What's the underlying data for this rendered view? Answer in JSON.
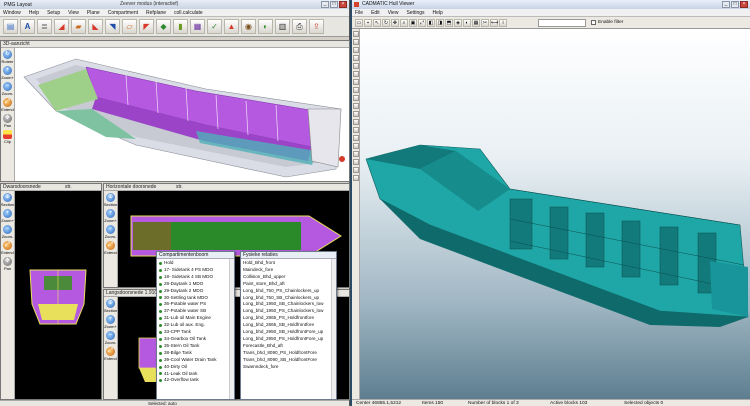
{
  "left_window": {
    "title": "PMG Layout",
    "document": "Zeever modus (interactief)",
    "menu": [
      "Window",
      "Help",
      "Setup",
      "View",
      "Plane",
      "Compartment",
      "Refplane",
      "coll.calculate"
    ],
    "pane_3d_caption": "3D-aanzicht",
    "pane_section_caption": "Dwarsdoorsnede",
    "pane_section_caption2": "str.",
    "pane_horizontal_caption": "Horizontale doorsnede",
    "pane_horizontal_caption2": "str.",
    "pane_longitudinal_caption": "Langsdoorsnede 1.910",
    "side_buttons": {
      "rotate": "Roteer",
      "zoom_in": "Zoom+",
      "zoom_out": "Zoom-",
      "extend": "Extend",
      "pan": "Pan",
      "clip": "Clip",
      "section": "Section"
    },
    "compartments": {
      "caption": "Compartimentenboom",
      "items": [
        "Hold",
        "17- Sidetank 4 PS MDO",
        "18- Sidetank 4 SB MDO",
        "28-Daytank 1 MDO",
        "29-Daytank 2 MDO",
        "30-Settling tank MDO",
        "36-Potable water PS",
        "37-Potable water SB",
        "31-Lub oil Main Engine",
        "32-Lub oil aux. Eng.",
        "33-CPP Tank",
        "34-Gearbox Oil Tank",
        "35-Stern Oil Tank",
        "38-Bilge Tank",
        "39-Cool Water Drain Tank",
        "40-Dirty Oil",
        "41-Leak Oil tank",
        "42-Overflow tank"
      ]
    },
    "walls": {
      "caption": "Fysieke relaties",
      "items": [
        "Hold_Bhd_front",
        "Maindeck_fore",
        "Collision_Bhd_upper",
        "Paint_store_Bhd_aft",
        "Long_bhd_750_PS_Chainlockers_up",
        "Long_bhd_750_SB_Chainlockers_up",
        "Long_bhd_1950_SB_Chainlockers_low",
        "Long_bhd_1950_PS_Chainlockers_low",
        "Long_bhd_2865_PS_Holdfrontfore",
        "Long_bhd_2865_SB_Holdfrontfore",
        "Long_bhd_2950_SB_HoldfrontFore_up",
        "Long_bhd_2950_PS_HoldfrontFore_up",
        "Forecastle_Bhd_aft",
        "Trans_bhd_8090_PS_HoldfrontFore",
        "Trans_bhd_8090_SB_HoldfrontFore",
        "Swamndeck_fore"
      ]
    },
    "status": "Selected: auto"
  },
  "right_window": {
    "title": "CADMATIC Hull Viewer",
    "menu": [
      "File",
      "Edit",
      "View",
      "Settings",
      "Help"
    ],
    "filter_label": "Enable filter",
    "status": {
      "center": "Center 46855.1,5212",
      "items": "Items 150",
      "blocks": "Number of blocks 1 of 3",
      "active": "Active blocks 103",
      "selected": "Selected objects 0"
    }
  },
  "colors": {
    "hull_teal": "#1fa6a6",
    "tank_magenta": "#b55ae0",
    "hull_yellow": "#e8e05a"
  }
}
